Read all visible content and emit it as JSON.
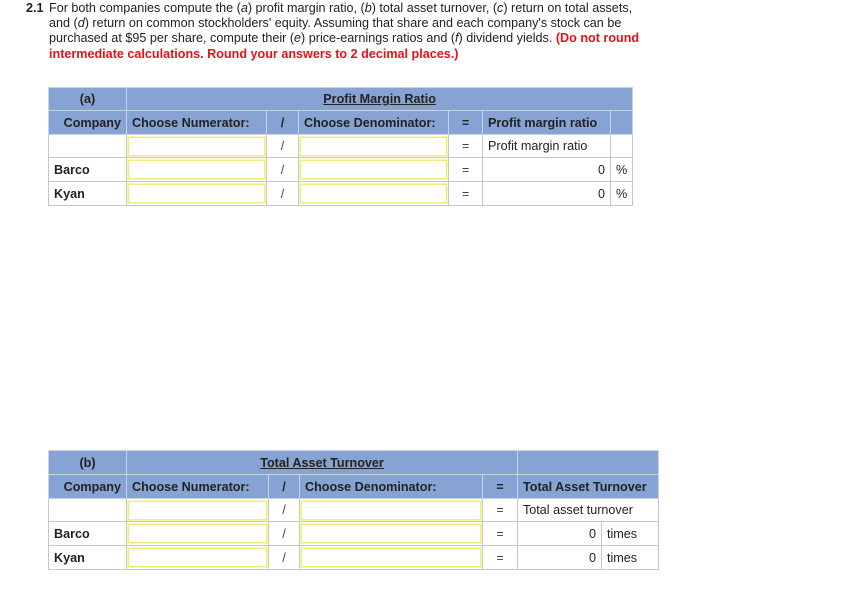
{
  "question": {
    "number": "2.1",
    "text_parts": [
      {
        "t": "For both companies compute the ",
        "style": "normal"
      },
      {
        "t": "(",
        "style": "normal"
      },
      {
        "t": "a",
        "style": "italic"
      },
      {
        "t": ") profit margin ratio, (",
        "style": "normal"
      },
      {
        "t": "b",
        "style": "italic"
      },
      {
        "t": ") total asset turnover, (",
        "style": "normal"
      },
      {
        "t": "c",
        "style": "italic"
      },
      {
        "t": ") return on total assets, and (",
        "style": "normal"
      },
      {
        "t": "d",
        "style": "italic"
      },
      {
        "t": ") return on common stockholders' equity. Assuming that share and each company's stock can be purchased at $95 per share, compute their (",
        "style": "normal"
      },
      {
        "t": "e",
        "style": "italic"
      },
      {
        "t": ") price-earnings ratios and (",
        "style": "normal"
      },
      {
        "t": "f",
        "style": "italic"
      },
      {
        "t": ") dividend yields. ",
        "style": "normal"
      },
      {
        "t": "(Do not round intermediate calculations. Round your answers to 2 decimal places.)",
        "style": "red"
      }
    ]
  },
  "tables": [
    {
      "part_label": "(a)",
      "title": "Profit Margin Ratio",
      "headers": {
        "company": "Company",
        "numerator": "Choose Numerator:",
        "divide": "/",
        "denominator": "Choose Denominator:",
        "equals": "=",
        "result": "Profit margin ratio"
      },
      "rows": [
        {
          "company": "",
          "numerator": "",
          "divide": "/",
          "denominator": "",
          "equals": "=",
          "result": "Profit margin ratio",
          "unit": ""
        },
        {
          "company": "Barco",
          "numerator": "",
          "divide": "/",
          "denominator": "",
          "equals": "=",
          "result": "0",
          "unit": "%"
        },
        {
          "company": "Kyan",
          "numerator": "",
          "divide": "/",
          "denominator": "",
          "equals": "=",
          "result": "0",
          "unit": "%"
        }
      ]
    },
    {
      "part_label": "(b)",
      "title": "Total Asset Turnover",
      "headers": {
        "company": "Company",
        "numerator": "Choose Numerator:",
        "divide": "/",
        "denominator": "Choose Denominator:",
        "equals": "=",
        "result": "Total Asset Turnover"
      },
      "rows": [
        {
          "company": "",
          "numerator": "",
          "divide": "/",
          "denominator": "",
          "equals": "=",
          "result": "Total asset turnover",
          "unit": ""
        },
        {
          "company": "Barco",
          "numerator": "",
          "divide": "/",
          "denominator": "",
          "equals": "=",
          "result": "0",
          "unit": "times"
        },
        {
          "company": "Kyan",
          "numerator": "",
          "divide": "/",
          "denominator": "",
          "equals": "=",
          "result": "0",
          "unit": "times"
        }
      ]
    }
  ]
}
